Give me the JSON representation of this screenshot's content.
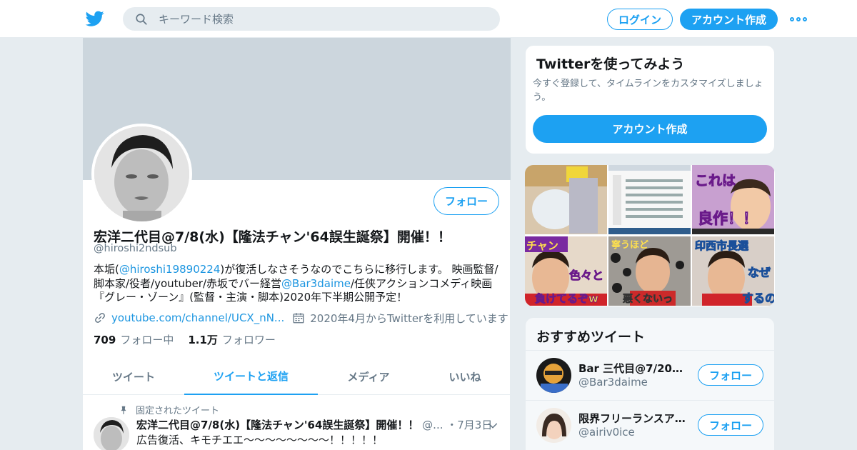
{
  "colors": {
    "accent": "#1da1f2",
    "link": "#1b95e0",
    "secondary_text": "#657786",
    "banner": "#ccd6dd",
    "background": "#e6ecf0"
  },
  "header": {
    "logo_icon": "twitter-bird-icon",
    "search_placeholder": "キーワード検索",
    "login_label": "ログイン",
    "signup_label": "アカウント作成",
    "more_icon": "more-dots-icon"
  },
  "profile": {
    "name": "宏洋二代目@7/8(水)【隆法チャン'64誤生誕祭】開催！！",
    "handle": "@hiroshi2ndsub",
    "follow_label": "フォロー",
    "bio": {
      "part1": "本垢(",
      "mention1": "@hiroshi19890224",
      "part2": ")が復活しなさそうなのでこちらに移行します。 映画監督/脚本家/役者/youtuber/赤坂でバー経営",
      "mention2": "@Bar3daime",
      "part3": "/任侠アクションコメディ映画『グレー・ゾーン』(監督・主演・脚本)2020年下半期公開予定！"
    },
    "link": "youtube.com/channel/UCX_nN...",
    "joined": "2020年4月からTwitterを利用しています",
    "following_count": "709",
    "following_label": "フォロー中",
    "followers_count": "1.1万",
    "followers_label": "フォロワー"
  },
  "tabs": [
    "ツイート",
    "ツイートと返信",
    "メディア",
    "いいね"
  ],
  "active_tab": 1,
  "pinned_tweet": {
    "pinned_label": "固定されたツイート",
    "author_name": "宏洋二代目@7/8(水)【隆法チャン'64誤生誕祭】開催！！",
    "author_handle": "@...",
    "date": "・7月3日",
    "text": "広告復活、キモチエエ〜〜〜〜〜〜〜〜！！！！！"
  },
  "signup_card": {
    "title": "Twitterを使ってみよう",
    "description": "今すぐ登録して、タイムラインをカスタマイズしましょう。",
    "cta_label": "アカウント作成"
  },
  "media_captions": {
    "tile3": "これは良作！！",
    "tile4_top": "チャン",
    "tile4_mid": "色々と",
    "tile4_bottom": "負けてるぞw",
    "tile5_top": "寧うほど",
    "tile5_bottom": "悪くないっ",
    "tile6_top": "印西市長選",
    "tile6_mid": "なぜ",
    "tile6_bottom": "するの"
  },
  "recommended": {
    "title": "おすすめツイート",
    "items": [
      {
        "name": "Bar 三代目@7/20店...",
        "handle": "@Bar3daime",
        "follow_label": "フォロー"
      },
      {
        "name": "限界フリーランスア...",
        "handle": "@airiv0ice",
        "follow_label": "フォロー"
      }
    ]
  }
}
